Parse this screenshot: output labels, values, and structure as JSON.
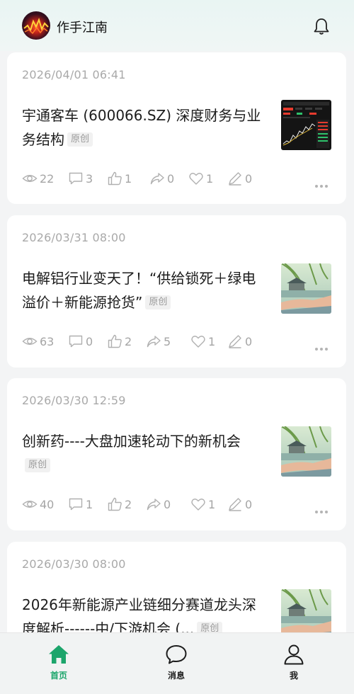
{
  "header": {
    "user_name": "作手江南",
    "avatar_icon": "avatar-image",
    "bell_icon": "bell-icon"
  },
  "colors": {
    "accent": "#1ca56b",
    "muted": "#a5a5a5",
    "tag_bg": "#f1f1f1"
  },
  "posts": [
    {
      "date": "2026/04/01 06:41",
      "title": "宇通客车 (600066.SZ) 深度财务与业务结构",
      "tag": "原创",
      "thumb": "stock-chart",
      "views": "22",
      "comments": "3",
      "likes": "1",
      "shares": "0",
      "favorites": "1",
      "edits": "0"
    },
    {
      "date": "2026/03/31 08:00",
      "title": "电解铝行业变天了！“供给锁死＋绿电溢价＋新能源抢货”",
      "tag": "原创",
      "thumb": "landscape-hand",
      "views": "63",
      "comments": "0",
      "likes": "2",
      "shares": "5",
      "favorites": "1",
      "edits": "0"
    },
    {
      "date": "2026/03/30 12:59",
      "title": "创新药----大盘加速轮动下的新机会",
      "tag": "原创",
      "thumb": "landscape-hand",
      "views": "40",
      "comments": "1",
      "likes": "2",
      "shares": "0",
      "favorites": "1",
      "edits": "0"
    },
    {
      "date": "2026/03/30 08:00",
      "title": "2026年新能源产业链细分赛道龙头深度解析------中/下游机会 (...",
      "tag": "原创",
      "thumb": "landscape-hand"
    }
  ],
  "tabs": [
    {
      "label": "首页",
      "icon": "home-icon",
      "active": true
    },
    {
      "label": "消息",
      "icon": "message-icon",
      "active": false
    },
    {
      "label": "我",
      "icon": "user-icon",
      "active": false
    }
  ]
}
